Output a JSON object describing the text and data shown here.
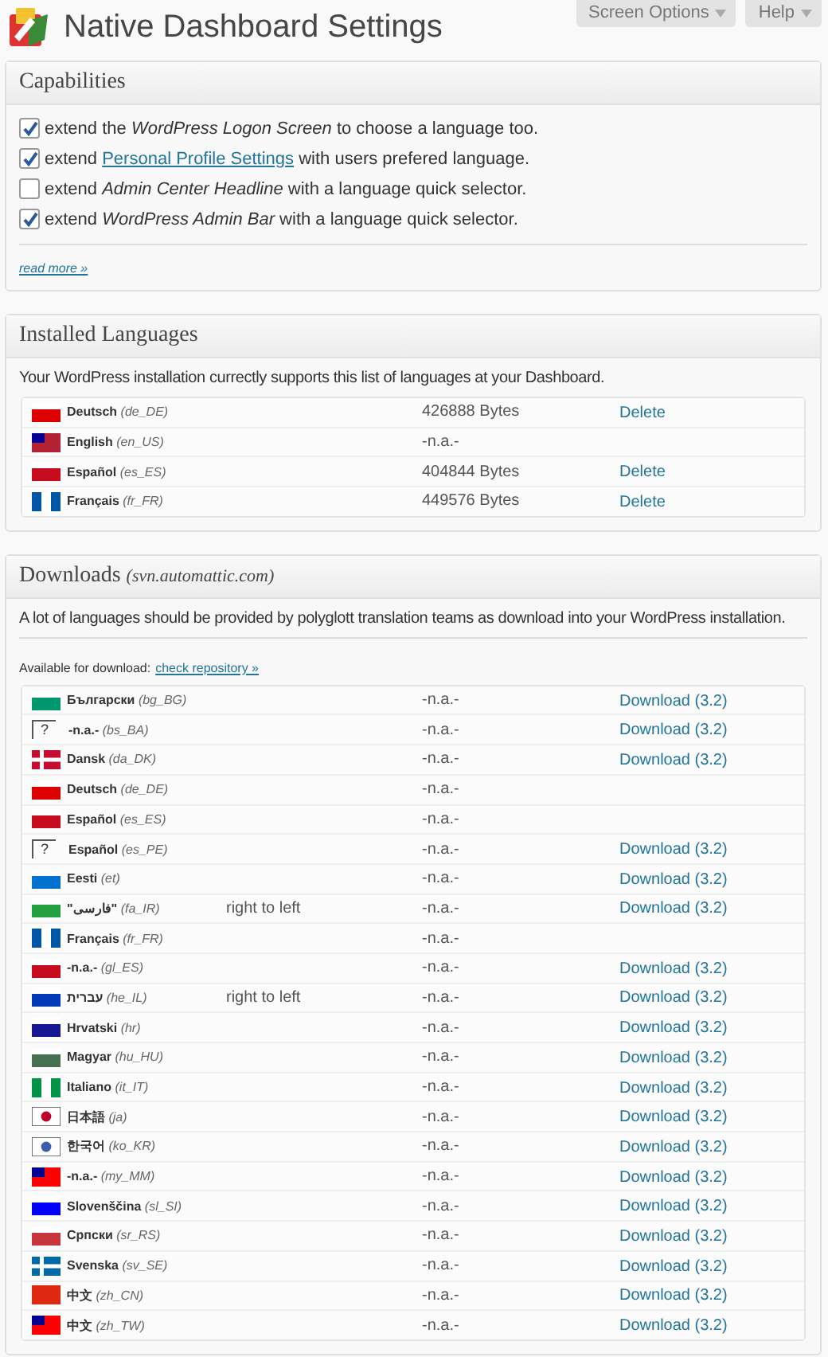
{
  "header": {
    "title": "Native Dashboard Settings",
    "tabs": [
      "Screen Options",
      "Help"
    ]
  },
  "capabilities": {
    "title": "Capabilities",
    "items": [
      {
        "checked": true,
        "text": "extend the *WordPress Logon Screen* to choose a language too."
      },
      {
        "checked": true,
        "before": "extend",
        "link": "Personal Profile Settings",
        "after": "with users prefered language."
      },
      {
        "checked": false,
        "text": "extend *Admin Center Headline* with a language quick selector."
      },
      {
        "checked": true,
        "text": "extend *WordPress Admin Bar* with a language quick selector."
      }
    ],
    "more_link": "read more »"
  },
  "installed": {
    "title": "Installed Languages",
    "intro": "Your WordPress installation currectly supports this list of languages at your Dashboard.",
    "rows": [
      {
        "name": "Deutsch",
        "code": "(de_DE)",
        "flag": {
          "kind": "horizontal",
          "color": "#dd0000"
        },
        "size": "426888 Bytes",
        "action": "Delete"
      },
      {
        "name": "English",
        "code": "(en_US)",
        "flag": {
          "kind": "canton",
          "color": "#b22234"
        },
        "size": "-n.a.-"
      },
      {
        "name": "Español",
        "code": "(es_ES)",
        "flag": {
          "kind": "horizontal",
          "color": "#c60b1e"
        },
        "size": "404844 Bytes",
        "action": "Delete"
      },
      {
        "name": "Français",
        "code": "(fr_FR)",
        "flag": {
          "kind": "vertical",
          "color": "#0055a4"
        },
        "size": "449576 Bytes",
        "action": "Delete"
      }
    ]
  },
  "downloads": {
    "title": "Downloads",
    "source": "(svn.automattic.com)",
    "intro": "A lot of languages should be provided by polyglott translation teams as download into your WordPress installation.",
    "available_label": "Available for download:",
    "repository_link": "check repository »",
    "rows": [
      {
        "name": "Български",
        "code": "(bg_BG)",
        "flag": {
          "kind": "horizontal",
          "color": "#00966e"
        },
        "size": "-n.a.-",
        "action": "Download (3.2)"
      },
      {
        "name": "-n.a.-",
        "code": "(bs_BA)",
        "flag": {
          "kind": "unknown",
          "mark": "?"
        },
        "size": "-n.a.-",
        "action": "Download (3.2)"
      },
      {
        "name": "Dansk",
        "code": "(da_DK)",
        "flag": {
          "kind": "cross",
          "color": "#c60c30"
        },
        "size": "-n.a.-",
        "action": "Download (3.2)"
      },
      {
        "name": "Deutsch",
        "code": "(de_DE)",
        "flag": {
          "kind": "horizontal",
          "color": "#dd0000"
        },
        "size": "-n.a.-"
      },
      {
        "name": "Español",
        "code": "(es_ES)",
        "flag": {
          "kind": "horizontal",
          "color": "#c60b1e"
        },
        "size": "-n.a.-"
      },
      {
        "name": "Español",
        "code": "(es_PE)",
        "flag": {
          "kind": "unknown",
          "mark": "?"
        },
        "size": "-n.a.-",
        "action": "Download (3.2)"
      },
      {
        "name": "Eesti",
        "code": "(et)",
        "flag": {
          "kind": "horizontal",
          "color": "#0072ce"
        },
        "size": "-n.a.-",
        "action": "Download (3.2)"
      },
      {
        "name": "\"فارسی\"",
        "code": "(fa_IR)",
        "flag": {
          "kind": "horizontal",
          "color": "#239f40"
        },
        "note": "right to left",
        "size": "-n.a.-",
        "action": "Download (3.2)"
      },
      {
        "name": "Français",
        "code": "(fr_FR)",
        "flag": {
          "kind": "vertical",
          "color": "#0055a4"
        },
        "size": "-n.a.-"
      },
      {
        "name": "-n.a.-",
        "code": "(gl_ES)",
        "flag": {
          "kind": "horizontal",
          "color": "#c60b1e"
        },
        "size": "-n.a.-",
        "action": "Download (3.2)"
      },
      {
        "name": "עברית",
        "code": "(he_IL)",
        "flag": {
          "kind": "horizontal",
          "color": "#0038b8"
        },
        "note": "right to left",
        "size": "-n.a.-",
        "action": "Download (3.2)"
      },
      {
        "name": "Hrvatski",
        "code": "(hr)",
        "flag": {
          "kind": "horizontal",
          "color": "#171796"
        },
        "size": "-n.a.-",
        "action": "Download (3.2)"
      },
      {
        "name": "Magyar",
        "code": "(hu_HU)",
        "flag": {
          "kind": "horizontal",
          "color": "#477050"
        },
        "size": "-n.a.-",
        "action": "Download (3.2)"
      },
      {
        "name": "Italiano",
        "code": "(it_IT)",
        "flag": {
          "kind": "vertical",
          "color": "#009246"
        },
        "size": "-n.a.-",
        "action": "Download (3.2)"
      },
      {
        "name": "日本語",
        "code": "(ja)",
        "flag": {
          "kind": "disc",
          "color": "#bc002d"
        },
        "size": "-n.a.-",
        "action": "Download (3.2)"
      },
      {
        "name": "한국어",
        "code": "(ko_KR)",
        "flag": {
          "kind": "disc",
          "color": "#3a5ea8"
        },
        "size": "-n.a.-",
        "action": "Download (3.2)"
      },
      {
        "name": "-n.a.-",
        "code": "(my_MM)",
        "flag": {
          "kind": "canton",
          "color": "#fe0000"
        },
        "size": "-n.a.-",
        "action": "Download (3.2)"
      },
      {
        "name": "Slovenščina",
        "code": "(sl_SI)",
        "flag": {
          "kind": "horizontal",
          "color": "#0000ff"
        },
        "size": "-n.a.-",
        "action": "Download (3.2)"
      },
      {
        "name": "Српски",
        "code": "(sr_RS)",
        "flag": {
          "kind": "horizontal",
          "color": "#c6363c"
        },
        "size": "-n.a.-",
        "action": "Download (3.2)"
      },
      {
        "name": "Svenska",
        "code": "(sv_SE)",
        "flag": {
          "kind": "cross",
          "color": "#006aa7"
        },
        "size": "-n.a.-",
        "action": "Download (3.2)"
      },
      {
        "name": "中文",
        "code": "(zh_CN)",
        "flag": {
          "kind": "plain",
          "color": "#de2910"
        },
        "size": "-n.a.-",
        "action": "Download (3.2)"
      },
      {
        "name": "中文",
        "code": "(zh_TW)",
        "flag": {
          "kind": "canton",
          "color": "#fe0000"
        },
        "size": "-n.a.-",
        "action": "Download (3.2)"
      }
    ]
  }
}
